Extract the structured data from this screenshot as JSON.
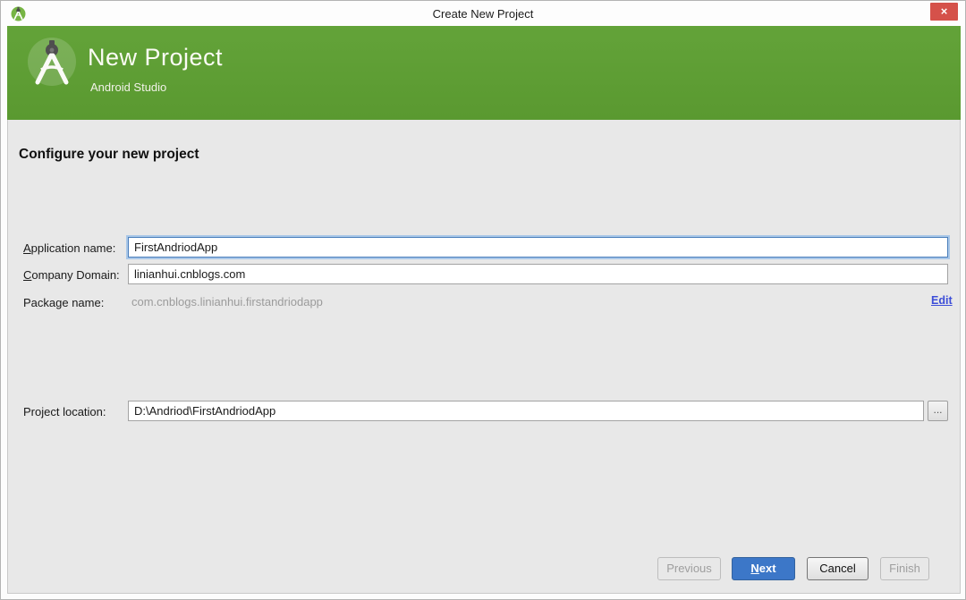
{
  "window": {
    "title": "Create New Project",
    "close_label": "×"
  },
  "banner": {
    "title": "New Project",
    "subtitle": "Android Studio"
  },
  "main": {
    "heading": "Configure your new project"
  },
  "fields": {
    "application_name": {
      "mnemonic": "A",
      "label_rest": "pplication name:",
      "value": "FirstAndriodApp"
    },
    "company_domain": {
      "mnemonic": "C",
      "label_rest": "ompany Domain:",
      "value": "linianhui.cnblogs.com"
    },
    "package_name": {
      "label": "Package name:",
      "value": "com.cnblogs.linianhui.firstandriodapp",
      "edit_label": "Edit"
    },
    "project_location": {
      "label": "Project location:",
      "value": "D:\\Andriod\\FirstAndriodApp",
      "browse_label": "..."
    }
  },
  "buttons": {
    "previous": {
      "label": "Previous",
      "enabled": false
    },
    "next": {
      "mnemonic": "N",
      "label_rest": "ext",
      "enabled": true
    },
    "cancel": {
      "label": "Cancel",
      "enabled": true
    },
    "finish": {
      "label": "Finish",
      "enabled": false
    }
  },
  "colors": {
    "banner-green": "#5a9930",
    "banner-green-light": "#63a339",
    "close-red": "#d5514a",
    "panel-gray": "#e8e8e8",
    "focus-blue": "#4a7ebb",
    "focus-glow": "#a9c7e8",
    "next-blue": "#3c77c8",
    "next-border": "#33629e",
    "link-blue": "#3d4ed8",
    "muted-text": "#9b9b9b"
  }
}
